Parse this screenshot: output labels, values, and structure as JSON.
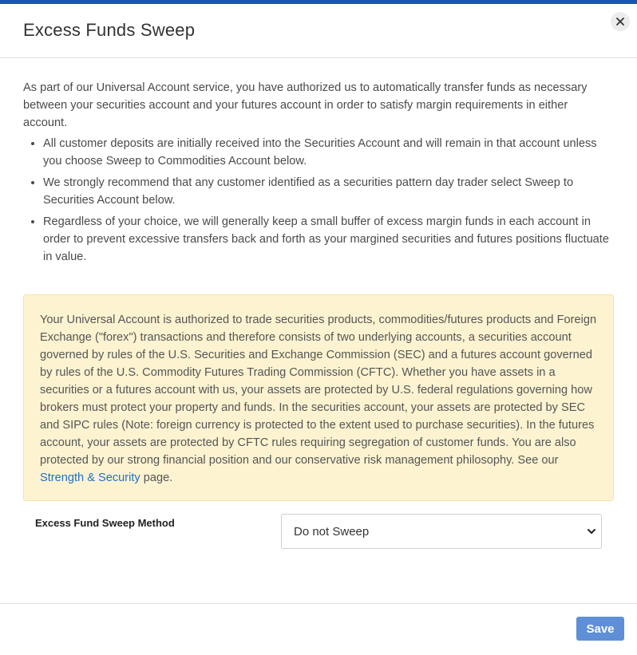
{
  "dialog": {
    "title": "Excess Funds Sweep",
    "close_icon": "close-icon"
  },
  "intro": "As part of our Universal Account service, you have authorized us to automatically transfer funds as necessary between your securities account and your futures account in order to satisfy margin requirements in either account.",
  "bullets": [
    "All customer deposits are initially received into the Securities Account and will remain in that account unless you choose Sweep to Commodities Account below.",
    "We strongly recommend that any customer identified as a securities pattern day trader select Sweep to Securities Account below.",
    "Regardless of your choice, we will generally keep a small buffer of excess margin funds in each account in order to prevent excessive transfers back and forth as your margined securities and futures positions fluctuate in value."
  ],
  "notice": {
    "text": "Your Universal Account is authorized to trade securities products, commodities/futures products and Foreign Exchange (\"forex\") transactions and therefore consists of two underlying accounts, a securities account governed by rules of the U.S. Securities and Exchange Commission (SEC) and a futures account governed by rules of the U.S. Commodity Futures Trading Commission (CFTC). Whether you have assets in a securities or a futures account with us, your assets are protected by U.S. federal regulations governing how brokers must protect your property and funds. In the securities account, your assets are protected by SEC and SIPC rules (Note: foreign currency is protected to the extent used to purchase securities). In the futures account, your assets are protected by CFTC rules requiring segregation of customer funds. You are also protected by our strong financial position and our conservative risk management philosophy. See our",
    "link_label": "Strength & Security",
    "after_link": "page."
  },
  "form": {
    "label": "Excess Fund Sweep Method",
    "selected": "Do not Sweep"
  },
  "footer": {
    "save_label": "Save"
  },
  "colors": {
    "accent": "#1a55b3",
    "notice_bg": "#fdf3d1",
    "save_button": "#5f8fd6",
    "link": "#1f6fc5"
  }
}
